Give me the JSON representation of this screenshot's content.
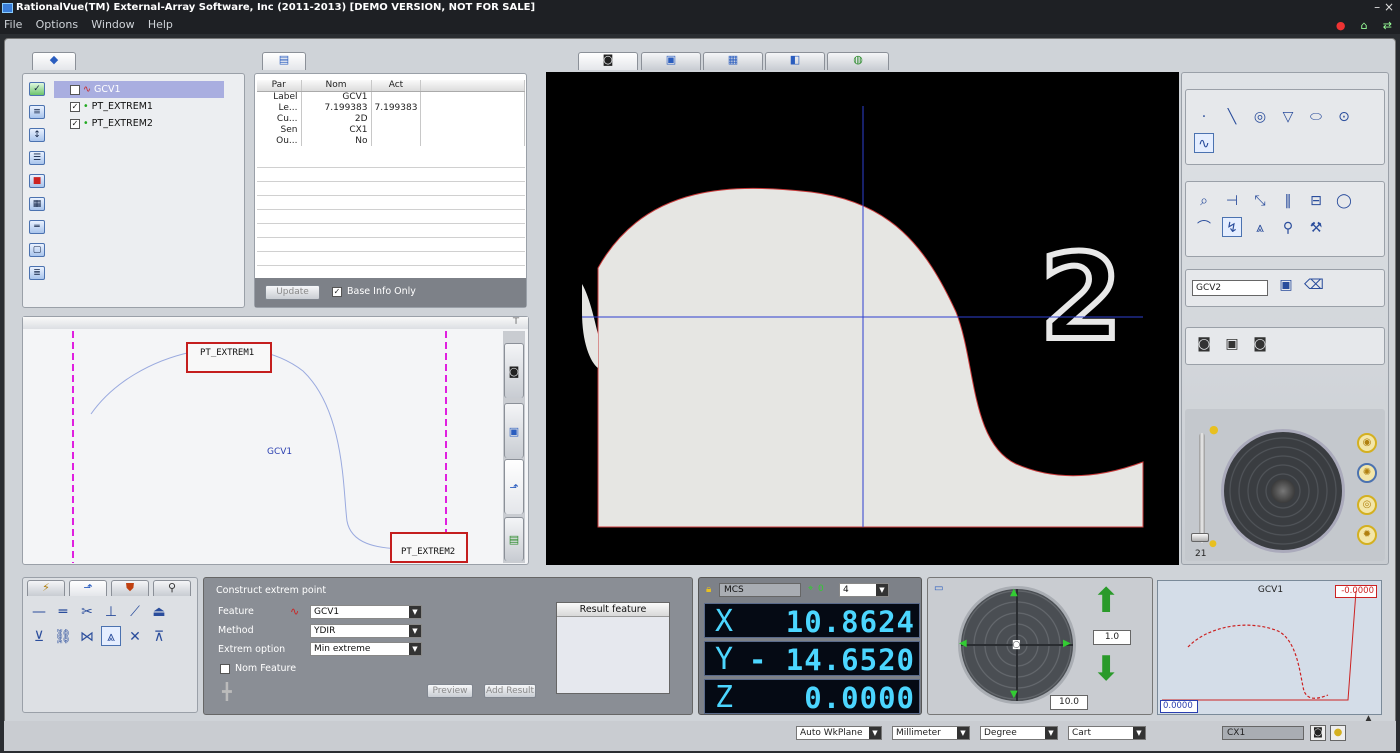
{
  "app": {
    "title": "RationalVue(TM) External-Array Software, Inc (2011-2013) [DEMO VERSION, NOT FOR SALE]",
    "minimize": "–",
    "close": "×"
  },
  "menu": [
    "File",
    "Options",
    "Window",
    "Help"
  ],
  "feature_tree": {
    "items": [
      {
        "label": "GCV1",
        "selected": true
      },
      {
        "label": "PT_EXTREM1",
        "selected": false
      },
      {
        "label": "PT_EXTREM2",
        "selected": false
      }
    ]
  },
  "param_table": {
    "headers": [
      "Par",
      "Nom",
      "Act"
    ],
    "rows": [
      [
        "Label",
        "GCV1",
        ""
      ],
      [
        "Le...",
        "7.199383",
        "7.199383"
      ],
      [
        "Cu...",
        "2D",
        ""
      ],
      [
        "Sen",
        "CX1",
        ""
      ],
      [
        "Ou...",
        "No",
        ""
      ]
    ],
    "update_label": "Update",
    "base_info_label": "Base Info Only"
  },
  "cad_view": {
    "labels": [
      "PT_EXTREM1",
      "GCV1",
      "PT_EXTREM2"
    ]
  },
  "camera": {
    "digit_text": "2"
  },
  "right_panel": {
    "feature_name": "GCV2",
    "light_value": "21"
  },
  "construct": {
    "title": "Construct extrem point",
    "feature_label": "Feature",
    "feature_value": "GCV1",
    "method_label": "Method",
    "method_value": "YDIR",
    "extrem_label": "Extrem option",
    "extrem_value": "Min extreme",
    "nom_feature_label": "Nom Feature",
    "result_header": "Result feature",
    "preview_label": "Preview",
    "add_result_label": "Add Result"
  },
  "dro": {
    "coord_system": "MCS",
    "offset_label": "0",
    "decimals": "4",
    "x_label": "X",
    "x_value": "10.8624",
    "y_label": "Y",
    "y_value": "- 14.6520",
    "z_label": "Z",
    "z_value": "0.0000"
  },
  "jog": {
    "step_value": "1.0",
    "speed_value": "10.0"
  },
  "profile": {
    "title": "GCV1",
    "top_value": "-0.0000",
    "bottom_value": "0.0000"
  },
  "statusbar": {
    "workplane": "Auto WkPlane",
    "units": "Millimeter",
    "angle": "Degree",
    "coords": "Cart",
    "sensor": "CX1"
  }
}
